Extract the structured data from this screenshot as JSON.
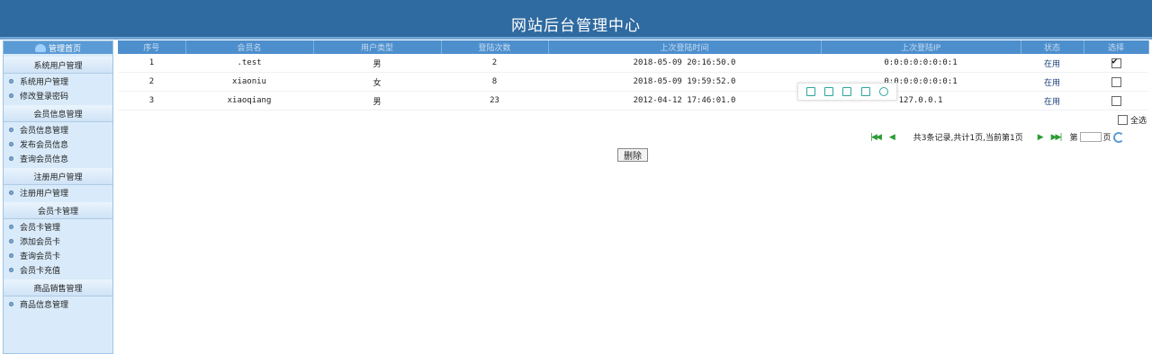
{
  "header": {
    "title": "网站后台管理中心"
  },
  "sidebar": {
    "top_label": "管理首页",
    "groups": [
      {
        "title": "系统用户管理",
        "items": [
          "系统用户管理",
          "修改登录密码"
        ]
      },
      {
        "title": "会员信息管理",
        "items": [
          "会员信息管理",
          "发布会员信息",
          "查询会员信息"
        ]
      },
      {
        "title": "注册用户管理",
        "items": [
          "注册用户管理"
        ]
      },
      {
        "title": "会员卡管理",
        "items": [
          "会员卡管理",
          "添加会员卡",
          "查询会员卡",
          "会员卡充值"
        ]
      },
      {
        "title": "商品销售管理",
        "items": [
          "商品信息管理"
        ]
      }
    ]
  },
  "table": {
    "headers": [
      "序号",
      "会员名",
      "用户类型",
      "登陆次数",
      "上次登陆时间",
      "上次登陆IP",
      "状态",
      "选择"
    ],
    "rows": [
      {
        "no": "1",
        "name": ".test",
        "type": "男",
        "count": "2",
        "last_time": "2018-05-09 20:16:50.0",
        "ip": "0:0:0:0:0:0:0:1",
        "status": "在用",
        "checked": true
      },
      {
        "no": "2",
        "name": "xiaoniu",
        "type": "女",
        "count": "8",
        "last_time": "2018-05-09 19:59:52.0",
        "ip": "0:0:0:0:0:0:0:1",
        "status": "在用",
        "checked": false
      },
      {
        "no": "3",
        "name": "xiaoqiang",
        "type": "男",
        "count": "23",
        "last_time": "2012-04-12 17:46:01.0",
        "ip": "127.0.0.1",
        "status": "在用",
        "checked": false
      }
    ],
    "select_all_label": "全选"
  },
  "pager": {
    "info": "共3条记录,共计1页,当前第1页",
    "page_prefix": "第",
    "page_suffix": "页"
  },
  "actions": {
    "delete_label": "删除"
  },
  "colors": {
    "header": "#2f6aa0",
    "table_header": "#4d8fcd",
    "sidebar": "#d9ebfa"
  },
  "icons": {
    "sidebar_top": "home-icon",
    "pager": [
      "first-page-icon",
      "prev-page-icon",
      "next-page-icon",
      "last-page-icon",
      "refresh-icon"
    ]
  }
}
